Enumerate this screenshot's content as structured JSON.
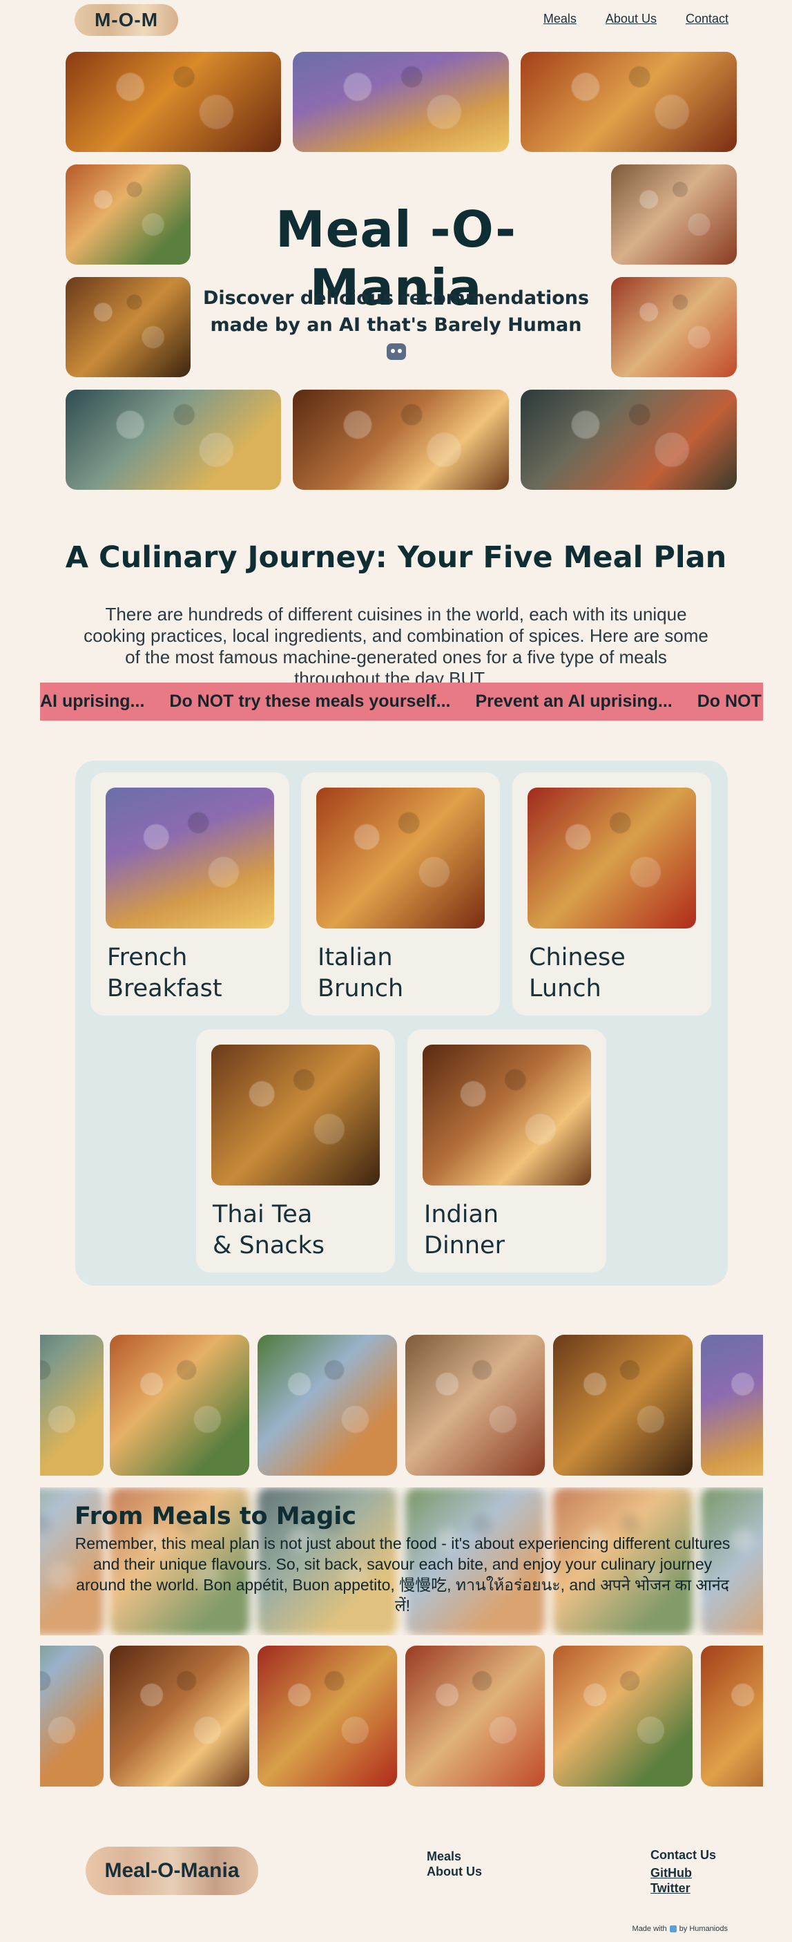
{
  "header": {
    "logo": "M-O-M",
    "nav": [
      "Meals",
      "About Us",
      "Contact"
    ]
  },
  "hero": {
    "title": "Meal -O- Mania",
    "subtitle_line1": "Discover delicious recommendations",
    "subtitle_line2": "made by an AI that's Barely Human"
  },
  "intro": {
    "title": "A Culinary Journey: Your Five Meal Plan",
    "paragraph": "There are hundreds of different cuisines in the world, each with its unique cooking practices, local ingredients, and combination of spices. Here are some of the most famous machine-generated ones for a five type of meals throughout the day BUT..."
  },
  "marquee": {
    "items": [
      "AI uprising...",
      "Do NOT try these meals yourself...",
      "Prevent an AI uprising...",
      "Do NOT try th"
    ]
  },
  "meals": [
    {
      "line1": "French",
      "line2": "Breakfast"
    },
    {
      "line1": "Italian",
      "line2": "Brunch"
    },
    {
      "line1": "Chinese",
      "line2": "Lunch"
    },
    {
      "line1": "Thai Tea",
      "line2": "& Snacks"
    },
    {
      "line1": "Indian",
      "line2": "Dinner"
    }
  ],
  "magic": {
    "title": "From Meals to Magic",
    "text": "Remember, this meal plan is not just about the food - it's about experiencing different cultures and their unique flavours. So, sit back, savour each bite, and enjoy your culinary journey around the world. Bon appétit, Buon appetito, 慢慢吃, ทานให้อร่อยนะ, and अपने भोजन का आनंद लें!"
  },
  "footer": {
    "logo": "Meal-O-Mania",
    "links_col1": [
      "Meals",
      "About Us"
    ],
    "contact_heading": "Contact Us",
    "contact_links": [
      "GitHub",
      "Twitter"
    ],
    "credit_prefix": "Made with",
    "credit_suffix": "by Humaniods"
  },
  "colors": {
    "background": "#f8f1ea",
    "marquee": "#e87a86",
    "meal_panel": "#dde9e9",
    "text": "#17303a"
  }
}
